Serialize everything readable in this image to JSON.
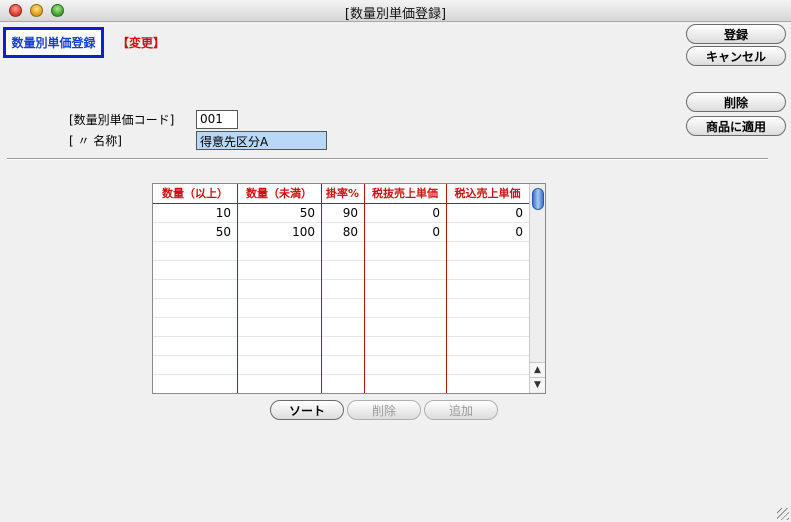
{
  "window": {
    "title": "[数量別単価登録]"
  },
  "header": {
    "screen_title": "数量別単価登録",
    "mode": "【変更】"
  },
  "buttons": {
    "register": "登録",
    "cancel": "キャンセル",
    "delete": "削除",
    "apply_to_products": "商品に適用",
    "sort": "ソート",
    "row_delete": "削除",
    "row_add": "追加"
  },
  "form": {
    "code_label": "[数量別単価コード]",
    "code_value": "001",
    "name_label": "[ 〃 名称]",
    "name_value": "得意先区分A"
  },
  "grid": {
    "columns": [
      "数量（以上）",
      "数量（未満）",
      "掛率%",
      "税抜売上単価",
      "税込売上単価"
    ],
    "rows": [
      [
        "10",
        "50",
        "90",
        "0",
        "0"
      ],
      [
        "50",
        "100",
        "80",
        "0",
        "0"
      ],
      [
        "",
        "",
        "",
        "",
        ""
      ],
      [
        "",
        "",
        "",
        "",
        ""
      ],
      [
        "",
        "",
        "",
        "",
        ""
      ],
      [
        "",
        "",
        "",
        "",
        ""
      ],
      [
        "",
        "",
        "",
        "",
        ""
      ],
      [
        "",
        "",
        "",
        "",
        ""
      ],
      [
        "",
        "",
        "",
        "",
        ""
      ],
      [
        "",
        "",
        "",
        "",
        ""
      ]
    ]
  },
  "colors": {
    "title_border": "#1020c8",
    "title_text": "#1a3fd0",
    "accent_red": "#d01010",
    "selection": "#b9d7f7"
  }
}
